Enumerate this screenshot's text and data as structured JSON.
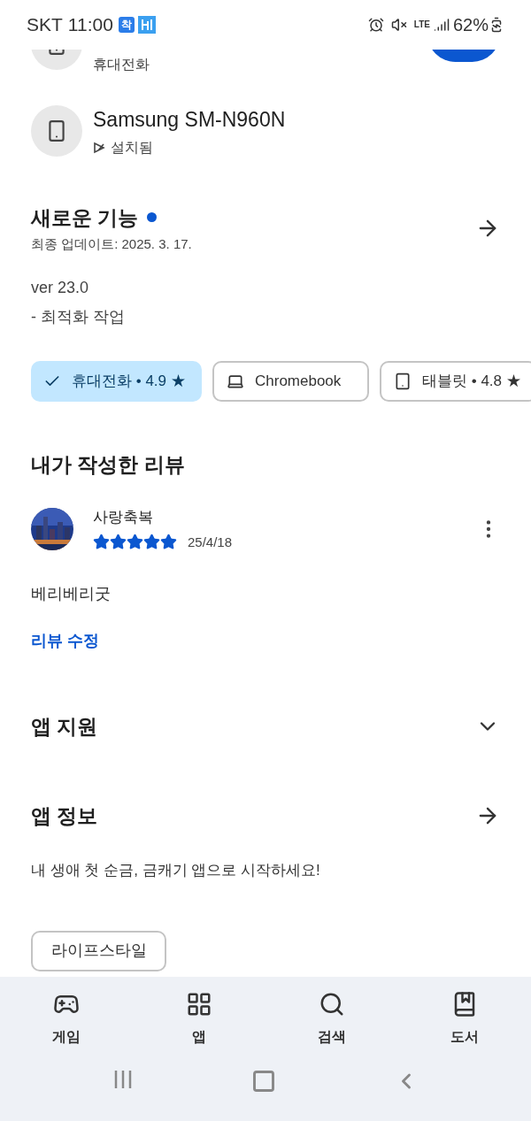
{
  "status_bar": {
    "carrier": "SKT",
    "time": "11:00",
    "app_badge": "착",
    "network": "LTE",
    "battery": "62%"
  },
  "devices": [
    {
      "kind": "cropped",
      "label": "휴대전화"
    },
    {
      "kind": "full",
      "name": "Samsung SM-N960N",
      "status": "설치됨"
    }
  ],
  "whats_new": {
    "title": "새로운 기능",
    "new": true,
    "updated": "최종 업데이트: 2025. 3. 17.",
    "lines": [
      "ver 23.0",
      "- 최적화 작업"
    ]
  },
  "device_chips": [
    {
      "kind": "phone",
      "label": "휴대전화 • 4.9 ★",
      "selected": true
    },
    {
      "kind": "laptop",
      "label": "Chromebook",
      "selected": false
    },
    {
      "kind": "tablet",
      "label": "태블릿 • 4.8 ★",
      "selected": false
    }
  ],
  "my_review": {
    "title": "내가 작성한 리뷰",
    "author": "사랑축복",
    "stars": 5,
    "date": "25/4/18",
    "text": "베리베리굿",
    "edit_link": "리뷰 수정"
  },
  "sections": [
    {
      "kind": "expand",
      "title": "앱 지원",
      "expanded": false
    },
    {
      "kind": "link",
      "title": "앱 정보",
      "description": "내 생애 첫 순금, 금캐기 앱으로 시작하세요!"
    }
  ],
  "category_chip": "라이프스타일",
  "bottom_nav": [
    {
      "kind": "games",
      "label": "게임"
    },
    {
      "kind": "apps",
      "label": "앱"
    },
    {
      "kind": "search",
      "label": "검색"
    },
    {
      "kind": "books",
      "label": "도서"
    }
  ]
}
